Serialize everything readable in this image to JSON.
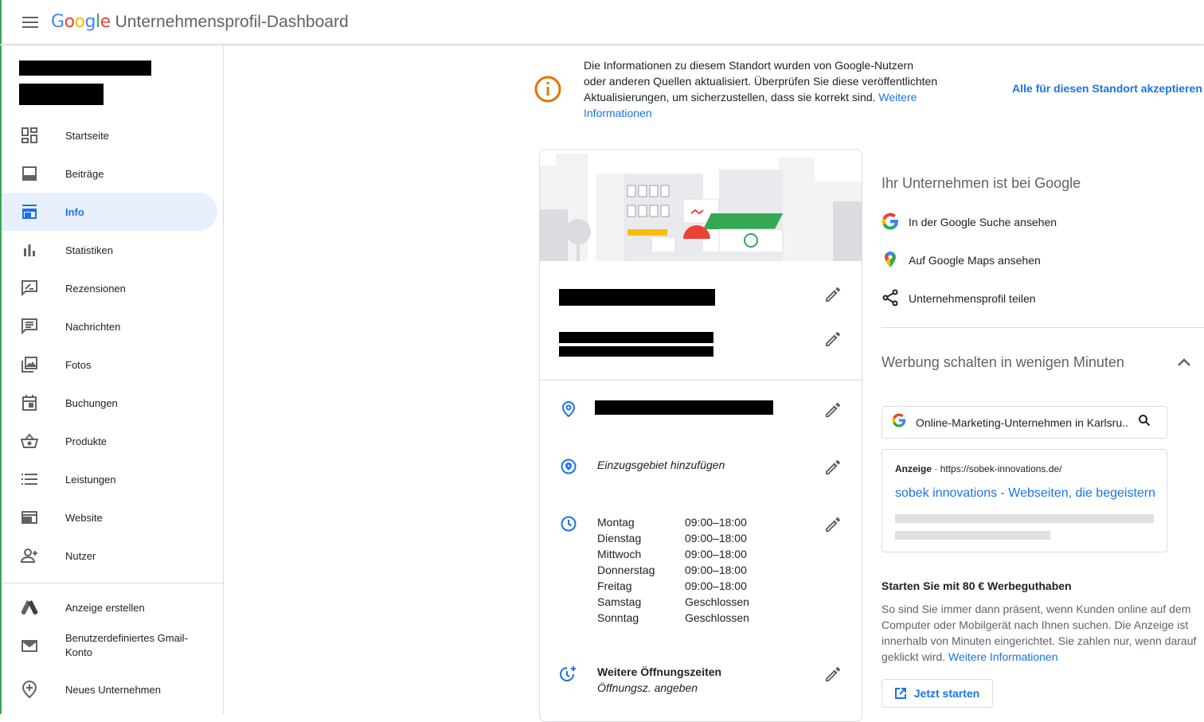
{
  "header": {
    "logo": [
      "G",
      "o",
      "o",
      "g",
      "l",
      "e"
    ],
    "title": "Unternehmensprofil-Dashboard"
  },
  "sidebar": {
    "items": [
      {
        "label": "Startseite",
        "icon": "dashboard-icon"
      },
      {
        "label": "Beiträge",
        "icon": "posts-icon"
      },
      {
        "label": "Info",
        "icon": "storefront-icon",
        "active": true
      },
      {
        "label": "Statistiken",
        "icon": "bar-chart-icon"
      },
      {
        "label": "Rezensionen",
        "icon": "rate-review-icon"
      },
      {
        "label": "Nachrichten",
        "icon": "message-icon"
      },
      {
        "label": "Fotos",
        "icon": "photo-library-icon"
      },
      {
        "label": "Buchungen",
        "icon": "calendar-icon"
      },
      {
        "label": "Produkte",
        "icon": "basket-icon"
      },
      {
        "label": "Leistungen",
        "icon": "list-icon"
      },
      {
        "label": "Website",
        "icon": "web-icon"
      },
      {
        "label": "Nutzer",
        "icon": "person-add-icon"
      }
    ],
    "secondary": [
      {
        "label": "Anzeige erstellen",
        "icon": "google-ads-icon"
      },
      {
        "label": "Benutzerdefiniertes Gmail-Konto",
        "icon": "gmail-icon"
      },
      {
        "label": "Neues Unternehmen",
        "icon": "add-location-icon"
      }
    ]
  },
  "banner": {
    "text": "Die Informationen zu diesem Standort wurden von Google-Nutzern oder anderen Quellen aktualisiert. Überprüfen Sie diese veröffentlichten Aktualisierungen, um sicherzustellen, dass sie korrekt sind.",
    "link": "Weitere Informationen",
    "accept_all": "Alle für diesen Standort akzeptieren"
  },
  "info_card": {
    "service_area": "Einzugsgebiet hinzufügen",
    "hours": [
      {
        "day": "Montag",
        "time": "09:00–18:00"
      },
      {
        "day": "Dienstag",
        "time": "09:00–18:00"
      },
      {
        "day": "Mittwoch",
        "time": "09:00–18:00"
      },
      {
        "day": "Donnerstag",
        "time": "09:00–18:00"
      },
      {
        "day": "Freitag",
        "time": "09:00–18:00"
      },
      {
        "day": "Samstag",
        "time": "Geschlossen"
      },
      {
        "day": "Sonntag",
        "time": "Geschlossen"
      }
    ],
    "more_hours_title": "Weitere Öffnungszeiten",
    "more_hours_sub": "Öffnungsz. angeben"
  },
  "right_panel": {
    "title": "Ihr Unternehmen ist bei Google",
    "links": [
      {
        "label": "In der Google Suche ansehen",
        "icon": "google-g-icon"
      },
      {
        "label": "Auf Google Maps ansehen",
        "icon": "google-maps-icon"
      },
      {
        "label": "Unternehmensprofil teilen",
        "icon": "share-icon"
      }
    ],
    "ads_title": "Werbung schalten in wenigen Minuten",
    "search_query": "Online-Marketing-Unternehmen in Karlsru...",
    "ad": {
      "label": "Anzeige",
      "url": "https://sobek-innovations.de/",
      "headline": "sobek innovations - Webseiten, die begeistern"
    },
    "promo_title": "Starten Sie mit 80 € Werbeguthaben",
    "promo_text": "So sind Sie immer dann präsent, wenn Kunden online auf dem Computer oder Mobilgerät nach Ihnen suchen. Die Anzeige ist innerhalb von Minuten eingerichtet. Sie zahlen nur, wenn darauf geklickt wird.",
    "promo_link": "Weitere Informationen",
    "start_button": "Jetzt starten"
  },
  "colors": {
    "accent": "#1a73e8",
    "active_bg": "#e8f0fe",
    "warning": "#e37400",
    "green": "#34a853"
  }
}
